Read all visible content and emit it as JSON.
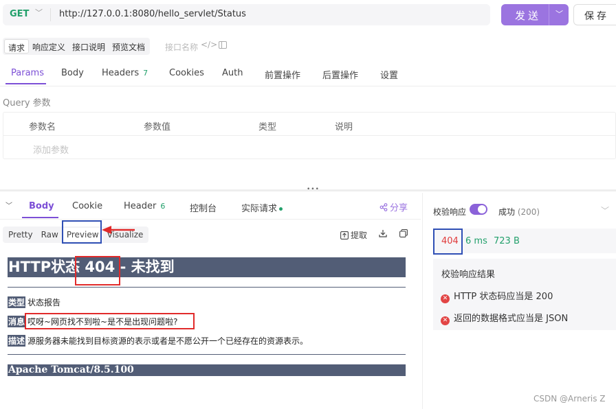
{
  "request": {
    "method": "GET",
    "url": "http://127.0.0.1:8080/hello_servlet/Status",
    "send_label": "发送",
    "save_label": "保存"
  },
  "sub_tabs": [
    "请求",
    "响应定义",
    "接口说明",
    "预览文档"
  ],
  "iface_name_placeholder": "接口名称",
  "code_icon_glyph": "</>",
  "main_tabs": [
    {
      "label": "Params"
    },
    {
      "label": "Body"
    },
    {
      "label": "Headers",
      "badge": "7"
    },
    {
      "label": "Cookies"
    },
    {
      "label": "Auth"
    },
    {
      "label": "前置操作"
    },
    {
      "label": "后置操作"
    },
    {
      "label": "设置"
    }
  ],
  "query": {
    "label": "Query 参数",
    "columns": [
      "参数名",
      "参数值",
      "类型",
      "说明"
    ],
    "add_placeholder": "添加参数"
  },
  "split_handle": "•••",
  "response_tabs": [
    {
      "label": "Body"
    },
    {
      "label": "Cookie"
    },
    {
      "label": "Header",
      "badge": "6"
    },
    {
      "label": "控制台"
    },
    {
      "label": "实际请求"
    }
  ],
  "share_label": "分享",
  "view_modes": [
    "Pretty",
    "Raw",
    "Preview",
    "Visualize"
  ],
  "tools": {
    "extract": "提取"
  },
  "preview": {
    "title_prefix": "HTTP状态",
    "title_code": "404",
    "title_suffix": "- 未找到",
    "rows": [
      {
        "label": "类型",
        "text": "状态报告"
      },
      {
        "label": "消息",
        "text": "哎呀~网页找不到啦~是不是出现问题啦?"
      },
      {
        "label": "描述",
        "text": "源服务器未能找到目标资源的表示或者是不愿公开一个已经存在的资源表示。"
      }
    ],
    "footer": "Apache Tomcat/8.5.100"
  },
  "validation": {
    "label": "校验响应",
    "selected": "成功",
    "selected_code": "(200)",
    "status_code": "404",
    "time": "6 ms",
    "size": "723 B",
    "results_title": "校验响应结果",
    "errors": [
      "HTTP 状态码应当是 200",
      "返回的数据格式应当是 JSON"
    ]
  },
  "watermark": "CSDN @Arneris Z",
  "colors": {
    "accent": "#7c4fd6",
    "send": "#9b74e0",
    "tomcat": "#525d76",
    "annotation_red": "#e12a2a",
    "annotation_blue": "#2f4fb5"
  }
}
